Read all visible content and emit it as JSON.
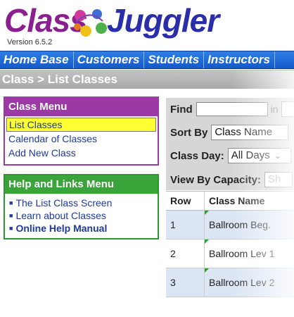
{
  "app": {
    "logo_word1": "Class",
    "logo_word2": "Juggler",
    "version": "Version 6.5.2"
  },
  "nav": {
    "items": [
      "Home Base",
      "Customers",
      "Students",
      "Instructors"
    ]
  },
  "breadcrumb": "Class > List Classes",
  "class_menu": {
    "title": "Class Menu",
    "items": [
      "List Classes",
      "Calendar of Classes",
      "Add New Class"
    ]
  },
  "help_menu": {
    "title": "Help and Links Menu",
    "items": [
      "The List Class Screen",
      "Learn about Classes",
      "Online Help Manual"
    ]
  },
  "filters": {
    "find_label": "Find",
    "find_value": "",
    "in_label": "in",
    "sort_label": "Sort By",
    "sort_value": "Class Name",
    "day_label": "Class Day:",
    "day_value": "All Days",
    "capacity_label": "View By Capacity:",
    "capacity_value": "Sh"
  },
  "table": {
    "headers": [
      "Row",
      "Class Name"
    ],
    "rows": [
      {
        "row": "1",
        "name": "Ballroom Beg."
      },
      {
        "row": "2",
        "name": "Ballroom Lev 1"
      },
      {
        "row": "3",
        "name": "Ballroom Lev 2"
      }
    ]
  },
  "colors": {
    "nav_blue": "#1a66d6",
    "class_menu_purple": "#9b3aa5",
    "help_menu_green": "#3aa33a",
    "selected_yellow": "#ffff33"
  }
}
